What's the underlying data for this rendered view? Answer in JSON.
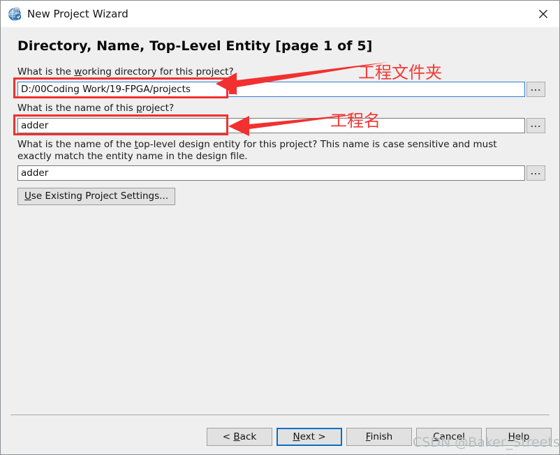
{
  "window": {
    "title": "New Project Wizard",
    "icon": "globe-wizard-icon",
    "close_label": "✕"
  },
  "page": {
    "title": "Directory, Name, Top-Level Entity [page 1 of 5]"
  },
  "fields": [
    {
      "label_before": "What is the ",
      "label_mnemonic": "w",
      "label_after": "orking directory for this project?",
      "label_plain": "What is the working directory for this project?",
      "value": "D:/00Coding Work/19-FPGA/projects",
      "browse_label": "...",
      "focused": true
    },
    {
      "label_before": "What is the name of this ",
      "label_mnemonic": "p",
      "label_after": "roject?",
      "label_plain": "What is the name of this project?",
      "value": "adder",
      "browse_label": "...",
      "focused": false
    },
    {
      "label_before": "What is the name of the ",
      "label_mnemonic": "t",
      "label_after": "op-level design entity for this project? This name is case sensitive and must exactly match the entity name in the design file.",
      "label_plain": "What is the name of the top-level design entity for this project? This name is case sensitive and must exactly match the entity name in the design file.",
      "value": "adder",
      "browse_label": "...",
      "focused": false
    }
  ],
  "existing_settings_button": {
    "mnemonic": "U",
    "rest": "se Existing Project Settings...",
    "plain": "Use Existing Project Settings..."
  },
  "footer_buttons": [
    {
      "before": "< ",
      "mnemonic": "B",
      "after": "ack",
      "plain": "< Back",
      "default": false
    },
    {
      "before": "",
      "mnemonic": "N",
      "after": "ext >",
      "plain": "Next >",
      "default": true
    },
    {
      "before": "",
      "mnemonic": "F",
      "after": "inish",
      "plain": "Finish",
      "default": false
    },
    {
      "before": "",
      "mnemonic": "C",
      "after": "ancel",
      "plain": "Cancel",
      "default": false
    },
    {
      "before": "",
      "mnemonic": "H",
      "after": "elp",
      "plain": "Help",
      "default": false
    }
  ],
  "annotations": [
    {
      "text": "工程文件夹",
      "name": "annotation-project-folder"
    },
    {
      "text": "工程名",
      "name": "annotation-project-name"
    }
  ],
  "watermark": "CSDN @Baker_Streets",
  "colors": {
    "annotation_red": "#f23030",
    "focus_blue": "#2a7fd4",
    "default_button_blue": "#0b6fc4",
    "dialog_bg": "#efefef",
    "titlebar_bg": "#ffffff"
  }
}
